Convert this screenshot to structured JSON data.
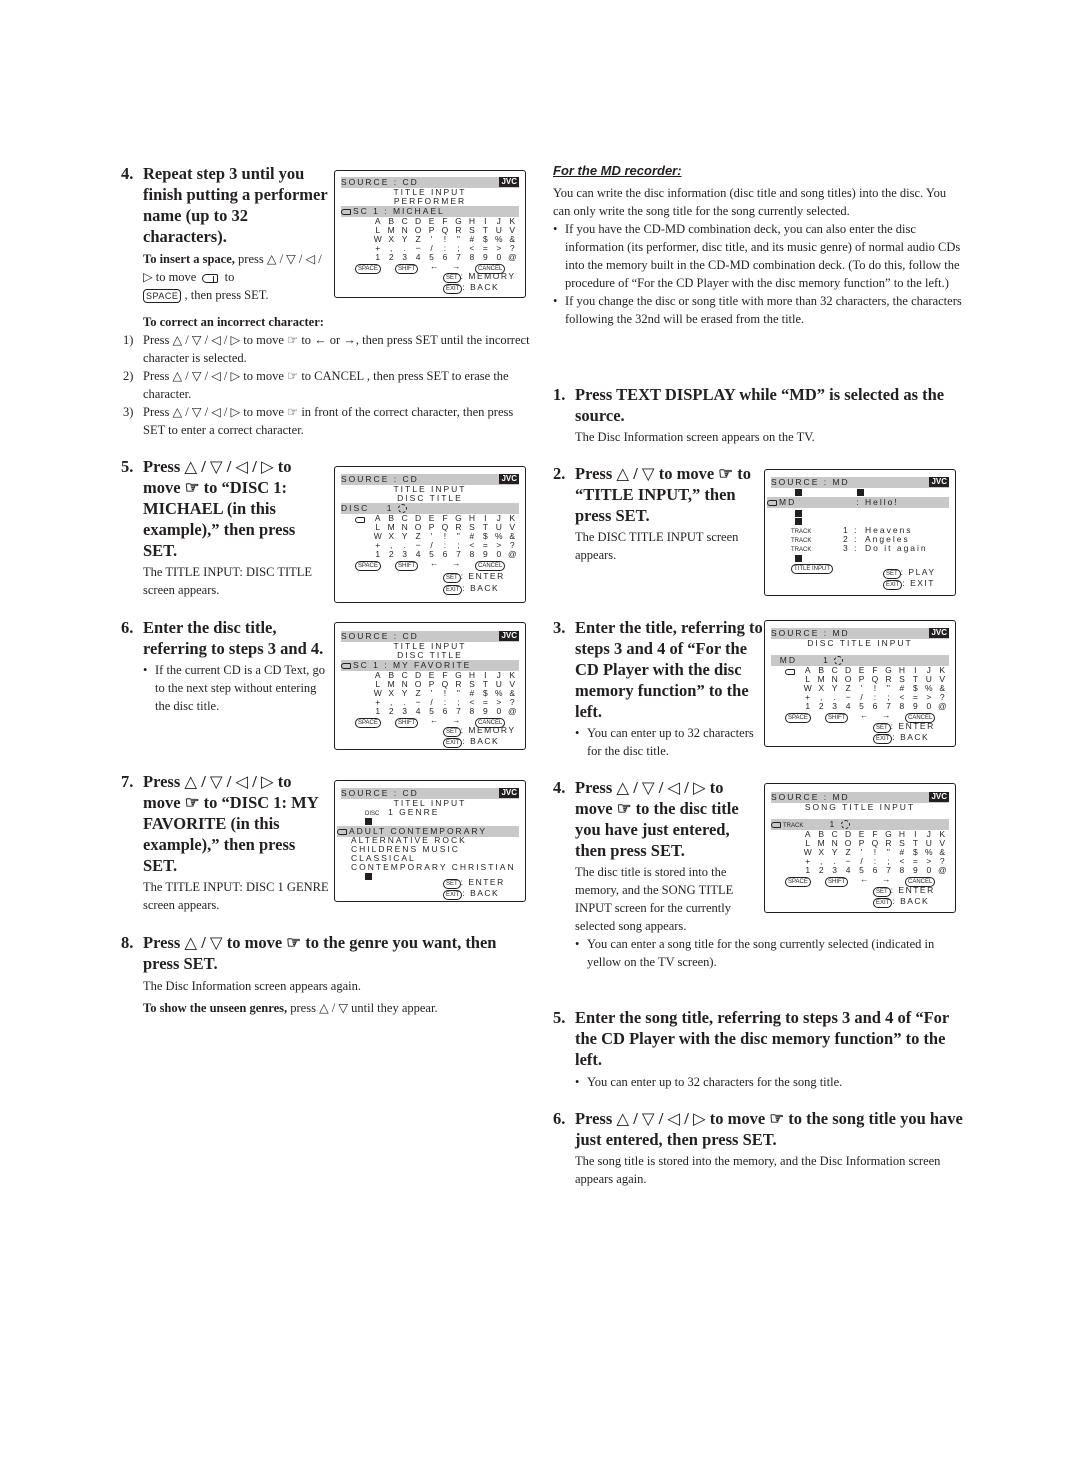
{
  "left": {
    "step4": {
      "num": "4.",
      "head": "Repeat step 3 until you finish putting a performer name (up to 32 characters).",
      "insert_space_label": "To insert a space,",
      "insert_space_text_a": "press △ / ▽ / ◁ / ▷ to move",
      "insert_space_text_b": "to",
      "insert_space_key": "SPACE",
      "insert_space_text_c": ", then press SET."
    },
    "correct": {
      "title": "To correct an incorrect character:",
      "items": [
        {
          "n": "1)",
          "text": "Press △ / ▽ / ◁ / ▷ to move ☞ to ← or →, then press SET until the incorrect character is selected."
        },
        {
          "n": "2)",
          "text": "Press △ / ▽ / ◁ / ▷ to move ☞ to CANCEL , then press SET to erase the character."
        },
        {
          "n": "3)",
          "text": "Press △ / ▽ / ◁ / ▷ to move ☞ in front of the correct character, then press SET to enter a correct character."
        }
      ]
    },
    "step5": {
      "num": "5.",
      "head": "Press △ / ▽ / ◁ / ▷ to move ☞ to “DISC 1: MICHAEL (in this example),” then press SET.",
      "body": "The TITLE INPUT: DISC TITLE screen appears."
    },
    "step6": {
      "num": "6.",
      "head": "Enter the disc title, referring to steps 3 and 4.",
      "bullet": "If the current CD is a CD Text, go to the next step without entering the disc title."
    },
    "step7": {
      "num": "7.",
      "head": "Press △ / ▽ / ◁ / ▷ to move ☞ to “DISC 1: MY FAVORITE (in this example),” then press SET.",
      "body": "The TITLE INPUT: DISC 1 GENRE screen appears."
    },
    "step8": {
      "num": "8.",
      "head": "Press △ / ▽ to move ☞ to the genre you want, then press SET.",
      "body": "The Disc Information screen appears again.",
      "note_label": "To show the unseen genres,",
      "note_text": "press △ / ▽ until they appear."
    }
  },
  "right": {
    "section_title": "For the MD recorder:",
    "intro": "You can write the disc information (disc title and song titles) into the disc. You can only write the song title for the song currently selected.",
    "bullets": [
      "If you have the CD-MD combination deck, you can also enter the disc information (its performer, disc title, and its music genre) of normal audio CDs into the memory built in the CD-MD combination deck. (To do this, follow the procedure of “For the CD Player with the disc memory function” to the left.)",
      "If you change the disc or song title with more than 32 characters, the characters following the 32nd will be erased from the title."
    ],
    "step1": {
      "num": "1.",
      "head": "Press TEXT DISPLAY while “MD” is selected as the source.",
      "body": "The Disc Information screen appears on the TV."
    },
    "step2": {
      "num": "2.",
      "head": "Press △ / ▽ to move ☞ to “TITLE INPUT,” then press SET.",
      "body": "The DISC TITLE INPUT screen appears."
    },
    "step3": {
      "num": "3.",
      "head": "Enter the title, referring to steps 3 and 4 of “For the CD Player with the disc memory function” to the left.",
      "bullet": "You can enter up to 32 characters for the disc title."
    },
    "step4": {
      "num": "4.",
      "head": "Press △ / ▽ / ◁ / ▷ to move ☞ to the disc title you have just entered, then press SET.",
      "body": "The disc title is stored into the memory, and the SONG TITLE INPUT screen for the currently selected song appears.",
      "bullet": "You can enter a song title for the song currently selected (indicated in yellow on the TV screen)."
    },
    "step5": {
      "num": "5.",
      "head": "Enter the song title, referring to steps 3 and 4 of “For the CD Player with the disc memory function” to the left.",
      "bullet": "You can enter up to 32 characters for the song title."
    },
    "step6": {
      "num": "6.",
      "head": "Press △ / ▽ / ◁ / ▷ to move ☞ to the song title you have just entered, then press SET.",
      "body": "The song title is stored into the memory, and the Disc Information screen appears again."
    }
  },
  "tv": {
    "brand": "JVC",
    "keyboard_rows": [
      [
        "A",
        "B",
        "C",
        "D",
        "E",
        "F",
        "G",
        "H",
        "I",
        "J",
        "K"
      ],
      [
        "L",
        "M",
        "N",
        "O",
        "P",
        "Q",
        "R",
        "S",
        "T",
        "U",
        "V"
      ],
      [
        "W",
        "X",
        "Y",
        "Z",
        "'",
        "!",
        "\"",
        "#",
        "$",
        "%",
        "&"
      ],
      [
        "+",
        ",",
        ".",
        "−",
        "/",
        ":",
        ";",
        "<",
        "=",
        ">",
        "?"
      ],
      [
        "1",
        "2",
        "3",
        "4",
        "5",
        "6",
        "7",
        "8",
        "9",
        "0",
        "@"
      ]
    ],
    "keys": {
      "space": "SPACE",
      "shift": "SHIFT",
      "cancel": "CANCEL",
      "left": "←",
      "right": "→",
      "set": "SET",
      "exit": "EXIT"
    },
    "screen_performer": {
      "source": "SOURCE :  CD",
      "title": "TITLE  INPUT",
      "sub": "PERFORMER",
      "field": "SC    1 : MICHAEL",
      "set_action": ": MEMORY",
      "exit_action": ": BACK"
    },
    "screen_disc_title": {
      "source": "SOURCE :  CD",
      "title": "TITLE  INPUT",
      "sub": "DISC  TITLE",
      "field_label": "DISC",
      "field_num": "1",
      "set_action": ": ENTER",
      "exit_action": ": BACK"
    },
    "screen_favorite": {
      "source": "SOURCE :  CD",
      "title": "TITLE  INPUT",
      "sub": "DISC  TITLE",
      "field": "SC    1 : MY  FAVORITE",
      "set_action": ": MEMORY",
      "exit_action": ": BACK"
    },
    "screen_genre": {
      "source": "SOURCE :  CD",
      "title": "TITEL  INPUT",
      "disc_label": "DISC",
      "sub": "1  GENRE",
      "genres": [
        "ADULT  CONTEMPORARY",
        "ALTERNATIVE  ROCK",
        "CHILDRENS  MUSIC",
        "CLASSICAL",
        "CONTEMPORARY  CHRISTIAN"
      ],
      "set_action": ": ENTER",
      "exit_action": ": BACK"
    },
    "screen_md_info": {
      "source": "SOURCE :  MD",
      "md_label": "MD",
      "md_value": ":   Hello!",
      "tracks": [
        {
          "label": "TRACK",
          "num": "1 :",
          "title": "Heavens"
        },
        {
          "label": "TRACK",
          "num": "2 :",
          "title": "Angeles"
        },
        {
          "label": "TRACK",
          "num": "3 :",
          "title": "Do  it  again"
        }
      ],
      "title_input_btn": "TITLE  INPUT",
      "set_action": ": PLAY",
      "exit_action": ": EXIT"
    },
    "screen_md_disc_title": {
      "source": "SOURCE :  MD",
      "title": "DISC  TITLE  INPUT",
      "field_label": "MD",
      "field_num": "1",
      "set_action": ": ENTER",
      "exit_action": ": BACK"
    },
    "screen_md_song_title": {
      "source": "SOURCE :  MD",
      "title": "SONG  TITLE  INPUT",
      "field_label": "TRACK",
      "field_num": "1",
      "set_action": ": ENTER",
      "exit_action": ": BACK"
    }
  }
}
